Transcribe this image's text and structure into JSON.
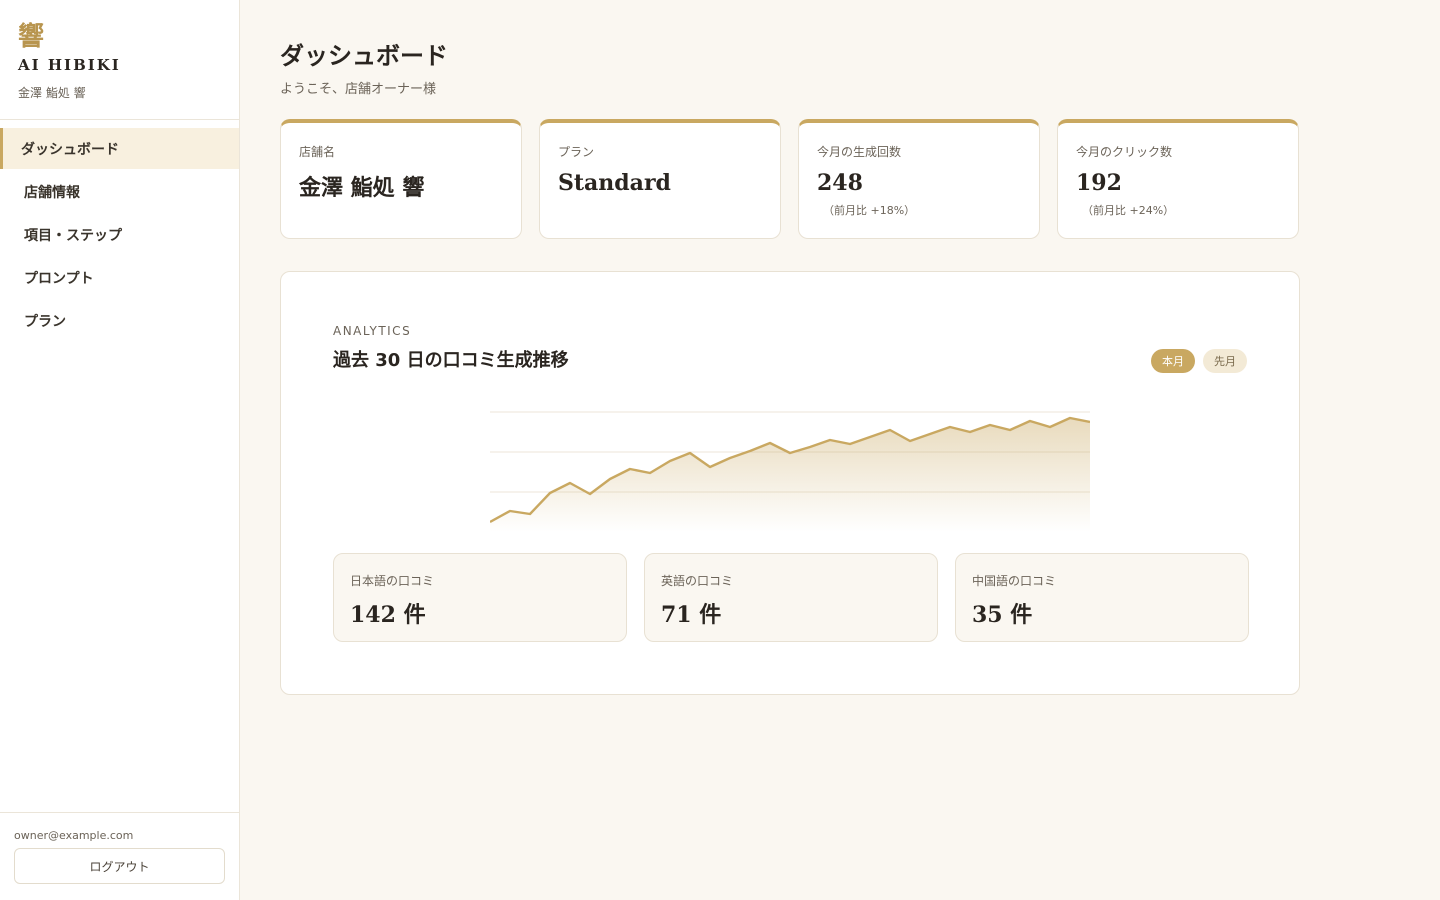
{
  "brand": {
    "glyph": "響",
    "name": "AI HIBIKI",
    "store": "金澤 鮨処 響"
  },
  "nav": {
    "items": [
      {
        "label": "ダッシュボード",
        "active": true
      },
      {
        "label": "店舗情報",
        "active": false
      },
      {
        "label": "項目・ステップ",
        "active": false
      },
      {
        "label": "プロンプト",
        "active": false
      },
      {
        "label": "プラン",
        "active": false
      }
    ]
  },
  "account": {
    "email": "owner@example.com",
    "logout_label": "ログアウト"
  },
  "header": {
    "title": "ダッシュボード",
    "subtitle": "ようこそ、店舗オーナー様"
  },
  "stats": [
    {
      "label": "店舗名",
      "value": "金澤 鮨処 響",
      "delta": ""
    },
    {
      "label": "プラン",
      "value": "Standard",
      "delta": ""
    },
    {
      "label": "今月の生成回数",
      "value": "248",
      "delta": "（前月比 +18%）"
    },
    {
      "label": "今月のクリック数",
      "value": "192",
      "delta": "（前月比 +24%）"
    }
  ],
  "analytics": {
    "eyebrow": "ANALYTICS",
    "title": "過去 30 日の口コミ生成推移",
    "toggles": [
      {
        "label": "本月",
        "active": true
      },
      {
        "label": "先月",
        "active": false
      }
    ]
  },
  "languages": [
    {
      "label": "日本語の口コミ",
      "value": "142 件"
    },
    {
      "label": "英語の口コミ",
      "value": "71 件"
    },
    {
      "label": "中国語の口コミ",
      "value": "35 件"
    }
  ],
  "colors": {
    "accent": "#c9a861",
    "accent_soft": "#f8f0df",
    "background": "#faf7f1"
  },
  "chart_data": {
    "type": "area",
    "title": "過去 30 日の口コミ生成推移",
    "xlabel": "",
    "ylabel": "",
    "grid": true,
    "ylim": [
      0,
      14
    ],
    "x": [
      1,
      2,
      3,
      4,
      5,
      6,
      7,
      8,
      9,
      10,
      11,
      12,
      13,
      14,
      15,
      16,
      17,
      18,
      19,
      20,
      21,
      22,
      23,
      24,
      25,
      26,
      27,
      28,
      29,
      30,
      31
    ],
    "values": [
      1.0,
      2.1,
      1.8,
      3.9,
      4.9,
      3.8,
      5.3,
      6.3,
      5.9,
      7.1,
      7.9,
      6.5,
      7.4,
      8.1,
      8.9,
      7.9,
      8.5,
      9.2,
      8.8,
      9.5,
      10.2,
      9.1,
      9.8,
      10.5,
      10.0,
      10.7,
      10.2,
      11.1,
      10.5,
      11.4,
      11.0
    ]
  }
}
